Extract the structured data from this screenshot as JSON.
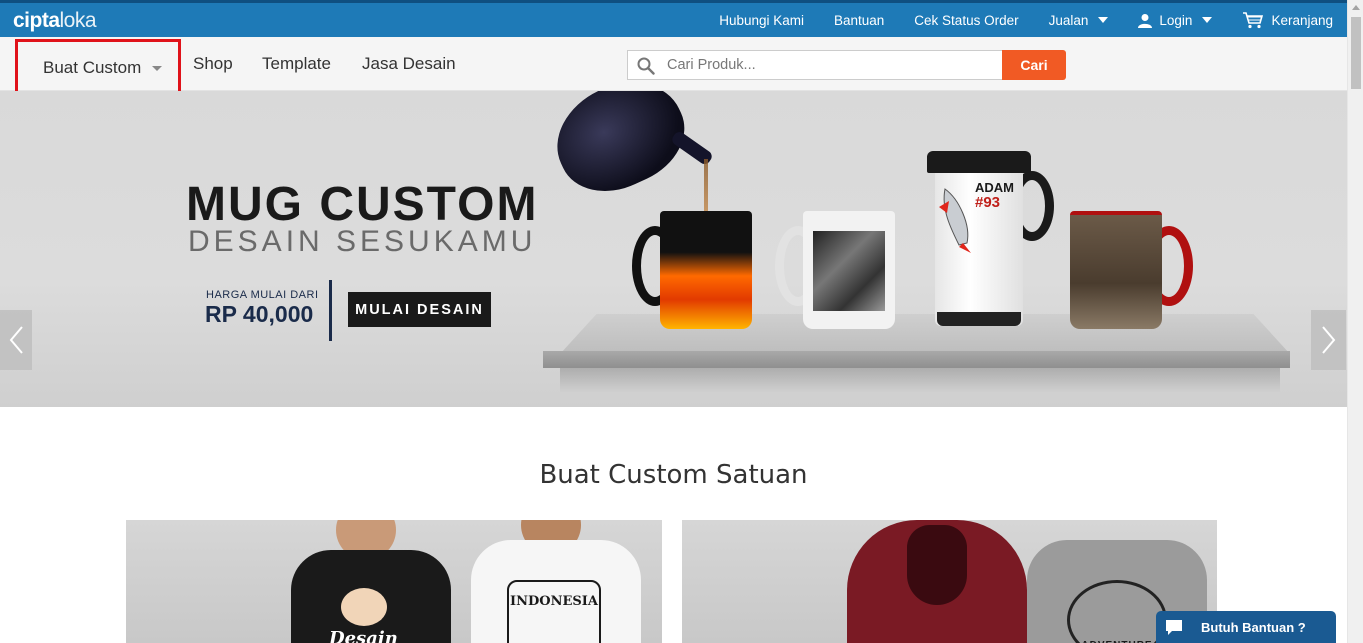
{
  "brand": {
    "logo_bold": "cipta",
    "logo_thin": "loka"
  },
  "topnav": {
    "contact": "Hubungi Kami",
    "help": "Bantuan",
    "order_status": "Cek Status Order",
    "sell": "Jualan",
    "login": "Login",
    "cart": "Keranjang"
  },
  "mainnav": {
    "custom": "Buat Custom",
    "shop": "Shop",
    "template": "Template",
    "design_service": "Jasa Desain"
  },
  "search": {
    "placeholder": "Cari Produk...",
    "button": "Cari"
  },
  "banner": {
    "title": "MUG CUSTOM",
    "subtitle": "DESAIN SESUKAMU",
    "price_label": "HARGA MULAI DARI",
    "price": "RP 40,000",
    "cta": "MULAI DESAIN",
    "mug_text_1": "ADAM",
    "mug_text_2": "#93"
  },
  "section": {
    "title": "Buat Custom Satuan",
    "card1_word": "Desain",
    "card1_label": "INDONESIA",
    "card2_label": "ADVENTURE"
  },
  "help_chat": {
    "label": "Butuh Bantuan ?"
  },
  "colors": {
    "topbar": "#1e7ab7",
    "accent": "#f15a24",
    "highlight_border": "#e0121a",
    "help_chat": "#1a5a92"
  }
}
